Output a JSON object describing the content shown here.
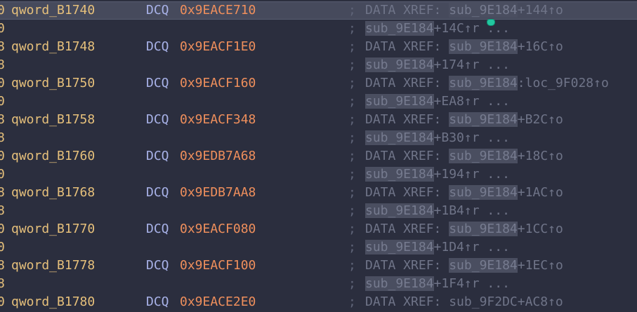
{
  "lines": [
    {
      "prefix": "0",
      "label": "qword_B1740",
      "mnemonic": "DCQ",
      "value": "0x9EACE710",
      "semi": ";",
      "xref_lead": "DATA XREF: ",
      "xref_sym": "sub_9E184",
      "xref_tail": "+144↑o",
      "highlight": true
    },
    {
      "prefix": "0",
      "label": "",
      "mnemonic": "",
      "value": "",
      "semi": ";",
      "xref_lead": "",
      "xref_sym": "sub_9E184",
      "xref_tail": "+14C↑r ...",
      "highlight": false
    },
    {
      "prefix": "8",
      "label": "qword_B1748",
      "mnemonic": "DCQ",
      "value": "0x9EACF1E0",
      "semi": ";",
      "xref_lead": "DATA XREF: ",
      "xref_sym": "sub_9E184",
      "xref_tail": "+16C↑o",
      "highlight": false
    },
    {
      "prefix": "8",
      "label": "",
      "mnemonic": "",
      "value": "",
      "semi": ";",
      "xref_lead": "",
      "xref_sym": "sub_9E184",
      "xref_tail": "+174↑r ...",
      "highlight": false
    },
    {
      "prefix": "0",
      "label": "qword_B1750",
      "mnemonic": "DCQ",
      "value": "0x9EACF160",
      "semi": ";",
      "xref_lead": "DATA XREF: ",
      "xref_sym": "sub_9E184",
      "xref_tail": ":loc_9F028↑o",
      "highlight": false
    },
    {
      "prefix": "0",
      "label": "",
      "mnemonic": "",
      "value": "",
      "semi": ";",
      "xref_lead": "",
      "xref_sym": "sub_9E184",
      "xref_tail": "+EA8↑r ...",
      "highlight": false
    },
    {
      "prefix": "8",
      "label": "qword_B1758",
      "mnemonic": "DCQ",
      "value": "0x9EACF348",
      "semi": ";",
      "xref_lead": "DATA XREF: ",
      "xref_sym": "sub_9E184",
      "xref_tail": "+B2C↑o",
      "highlight": false
    },
    {
      "prefix": "8",
      "label": "",
      "mnemonic": "",
      "value": "",
      "semi": ";",
      "xref_lead": "",
      "xref_sym": "sub_9E184",
      "xref_tail": "+B30↑r ...",
      "highlight": false
    },
    {
      "prefix": "0",
      "label": "qword_B1760",
      "mnemonic": "DCQ",
      "value": "0x9EDB7A68",
      "semi": ";",
      "xref_lead": "DATA XREF: ",
      "xref_sym": "sub_9E184",
      "xref_tail": "+18C↑o",
      "highlight": false
    },
    {
      "prefix": "0",
      "label": "",
      "mnemonic": "",
      "value": "",
      "semi": ";",
      "xref_lead": "",
      "xref_sym": "sub_9E184",
      "xref_tail": "+194↑r ...",
      "highlight": false
    },
    {
      "prefix": "8",
      "label": "qword_B1768",
      "mnemonic": "DCQ",
      "value": "0x9EDB7AA8",
      "semi": ";",
      "xref_lead": "DATA XREF: ",
      "xref_sym": "sub_9E184",
      "xref_tail": "+1AC↑o",
      "highlight": false
    },
    {
      "prefix": "8",
      "label": "",
      "mnemonic": "",
      "value": "",
      "semi": ";",
      "xref_lead": "",
      "xref_sym": "sub_9E184",
      "xref_tail": "+1B4↑r ...",
      "highlight": false
    },
    {
      "prefix": "0",
      "label": "qword_B1770",
      "mnemonic": "DCQ",
      "value": "0x9EACF080",
      "semi": ";",
      "xref_lead": "DATA XREF: ",
      "xref_sym": "sub_9E184",
      "xref_tail": "+1CC↑o",
      "highlight": false
    },
    {
      "prefix": "0",
      "label": "",
      "mnemonic": "",
      "value": "",
      "semi": ";",
      "xref_lead": "",
      "xref_sym": "sub_9E184",
      "xref_tail": "+1D4↑r ...",
      "highlight": false
    },
    {
      "prefix": "8",
      "label": "qword_B1778",
      "mnemonic": "DCQ",
      "value": "0x9EACF100",
      "semi": ";",
      "xref_lead": "DATA XREF: ",
      "xref_sym": "sub_9E184",
      "xref_tail": "+1EC↑o",
      "highlight": false
    },
    {
      "prefix": "8",
      "label": "",
      "mnemonic": "",
      "value": "",
      "semi": ";",
      "xref_lead": "",
      "xref_sym": "sub_9E184",
      "xref_tail": "+1F4↑r ...",
      "highlight": false
    },
    {
      "prefix": "0",
      "label": "qword_B1780",
      "mnemonic": "DCQ",
      "value": "0x9EACE2E0",
      "semi": ";",
      "xref_lead": "DATA XREF: ",
      "xref_sym": "",
      "xref_tail": "sub_9F2DC+AC8↑o",
      "highlight": false
    }
  ],
  "colors": {
    "background": "#2b2e3e",
    "label": "#e6c07b",
    "mnemonic": "#a8b2e8",
    "value": "#ef8f5c",
    "comment": "#6f7488",
    "cursor": "#22c7a0"
  }
}
